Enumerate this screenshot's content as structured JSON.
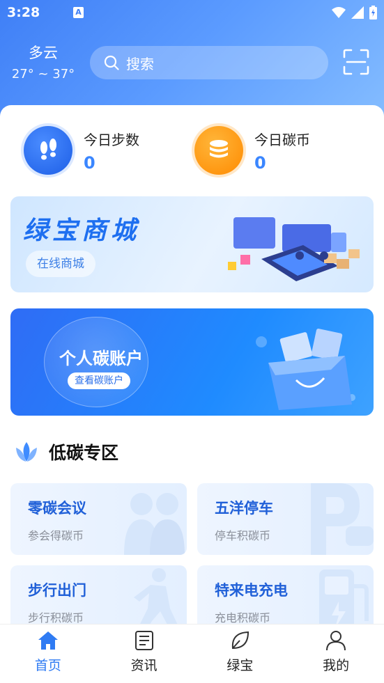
{
  "status_bar": {
    "time": "3:28",
    "notif_icon": "A"
  },
  "weather": {
    "condition": "多云",
    "temp_range": "27° ~ 37°"
  },
  "search": {
    "placeholder": "搜索"
  },
  "stats": [
    {
      "label": "今日步数",
      "value": "0",
      "icon": "footprints-icon"
    },
    {
      "label": "今日碳币",
      "value": "0",
      "icon": "coin-stack-icon"
    }
  ],
  "banners": {
    "mall": {
      "title": "绿宝商城",
      "button": "在线商城"
    },
    "account": {
      "title": "个人碳账户",
      "button": "查看碳账户"
    }
  },
  "section": {
    "title": "低碳专区"
  },
  "tiles": [
    {
      "title": "零碳会议",
      "subtitle": "参会得碳币"
    },
    {
      "title": "五洋停车",
      "subtitle": "停车积碳币"
    },
    {
      "title": "步行出门",
      "subtitle": "步行积碳币"
    },
    {
      "title": "特来电充电",
      "subtitle": "充电积碳币"
    }
  ],
  "tabs": [
    {
      "label": "首页",
      "icon": "home-icon",
      "active": true
    },
    {
      "label": "资讯",
      "icon": "news-icon",
      "active": false
    },
    {
      "label": "绿宝",
      "icon": "leaf-icon",
      "active": false
    },
    {
      "label": "我的",
      "icon": "user-icon",
      "active": false
    }
  ],
  "colors": {
    "primary": "#2f7bf3",
    "header": "#3f7ff6",
    "coin": "#ff8a00"
  }
}
